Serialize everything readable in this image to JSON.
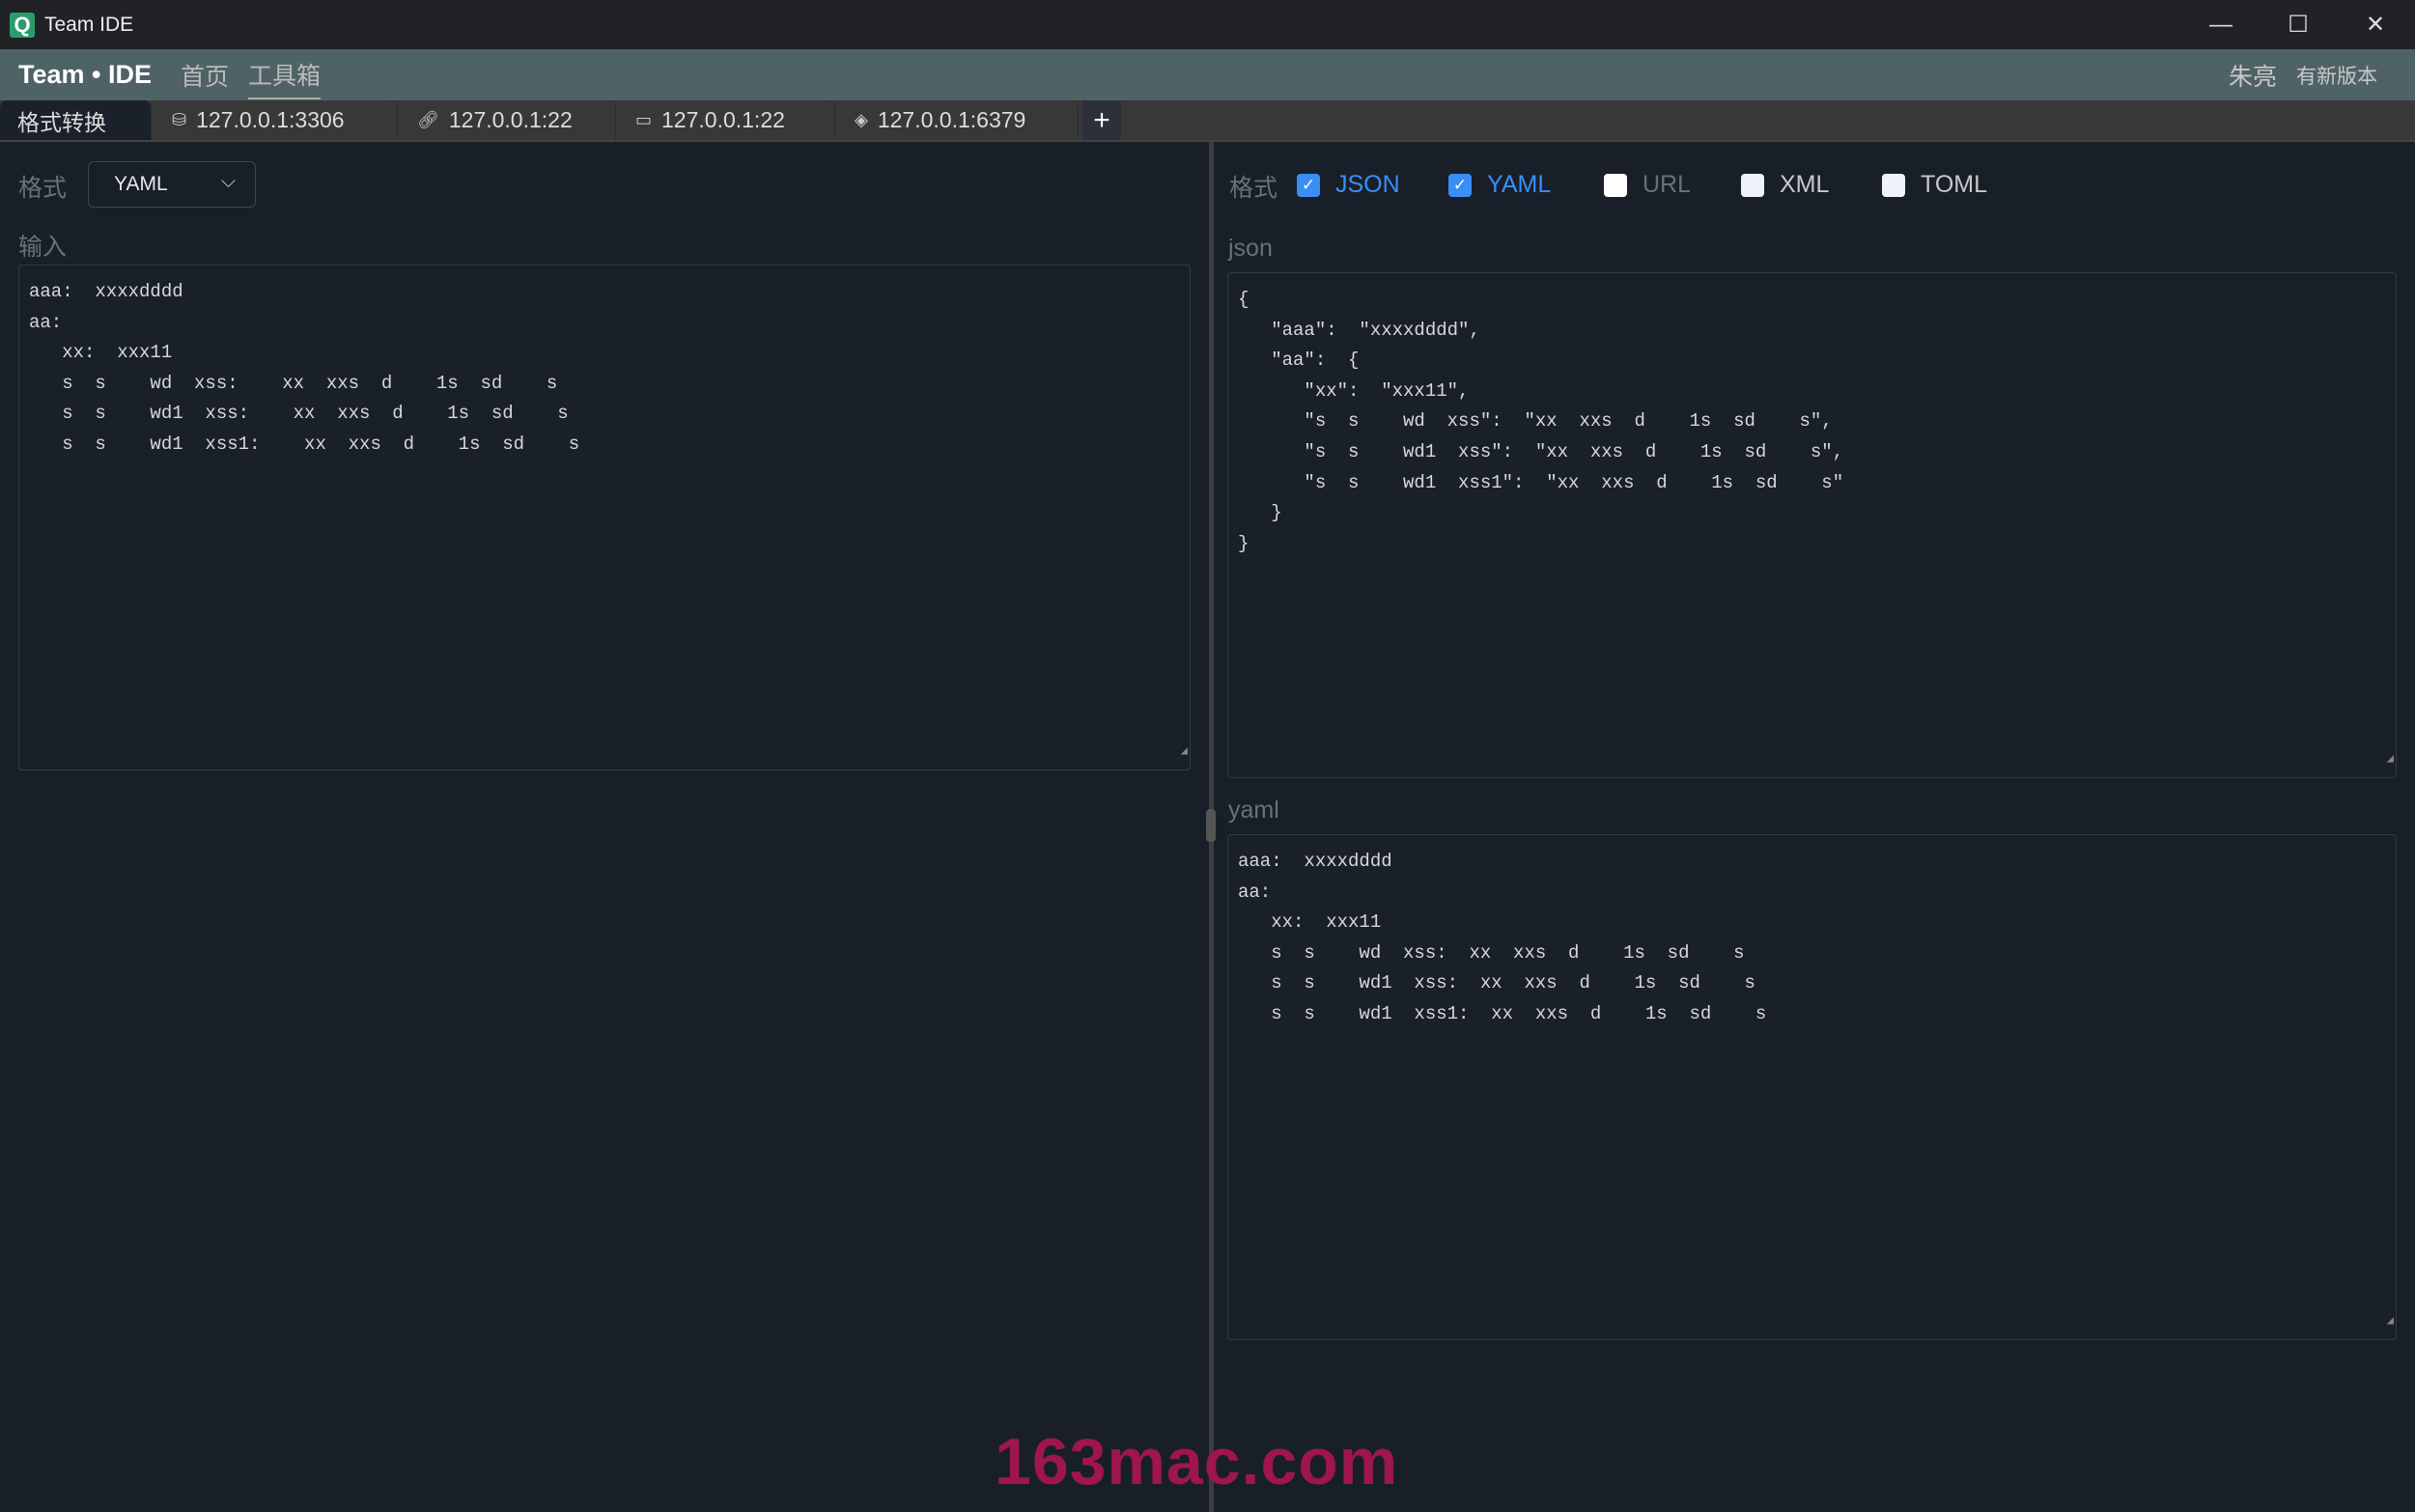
{
  "window": {
    "title": "Team IDE",
    "minimize": "—",
    "maximize": "☐",
    "close": "✕"
  },
  "header": {
    "brand": "Team • IDE",
    "nav": [
      {
        "label": "首页"
      },
      {
        "label": "工具箱",
        "active": true
      }
    ],
    "user": "朱亮",
    "update": "有新版本"
  },
  "tabs": [
    {
      "label": "格式转换",
      "icon": ""
    },
    {
      "label": "127.0.0.1:3306",
      "icon": "database-icon"
    },
    {
      "label": "127.0.0.1:22",
      "icon": "link-icon"
    },
    {
      "label": "127.0.0.1:22",
      "icon": "ftp-icon"
    },
    {
      "label": "127.0.0.1:6379",
      "icon": "redis-icon"
    }
  ],
  "add_tab": "+",
  "left": {
    "format_label": "格式",
    "format_value": "YAML",
    "input_label": "输入",
    "input": "aaa:  xxxxdddd\naa:\n   xx:  xxx11\n   s  s    wd  xss:    xx  xxs  d    1s  sd    s\n   s  s    wd1  xss:    xx  xxs  d    1s  sd    s\n   s  s    wd1  xss1:    xx  xxs  d    1s  sd    s"
  },
  "right": {
    "format_label": "格式",
    "options": [
      {
        "label": "JSON",
        "checked": true
      },
      {
        "label": "YAML",
        "checked": true
      },
      {
        "label": "URL",
        "checked": false
      },
      {
        "label": "XML",
        "checked": false
      },
      {
        "label": "TOML",
        "checked": false
      }
    ],
    "json_label": "json",
    "json": "{\n   \"aaa\":  \"xxxxdddd\",\n   \"aa\":  {\n      \"xx\":  \"xxx11\",\n      \"s  s    wd  xss\":  \"xx  xxs  d    1s  sd    s\",\n      \"s  s    wd1  xss\":  \"xx  xxs  d    1s  sd    s\",\n      \"s  s    wd1  xss1\":  \"xx  xxs  d    1s  sd    s\"\n   }\n}",
    "yaml_label": "yaml",
    "yaml": "aaa:  xxxxdddd\naa:\n   xx:  xxx11\n   s  s    wd  xss:  xx  xxs  d    1s  sd    s\n   s  s    wd1  xss:  xx  xxs  d    1s  sd    s\n   s  s    wd1  xss1:  xx  xxs  d    1s  sd    s"
  },
  "watermark": "163mac.com",
  "colors": {
    "accent": "#3a8ef6",
    "header": "#4f6266",
    "background": "#181f29"
  }
}
